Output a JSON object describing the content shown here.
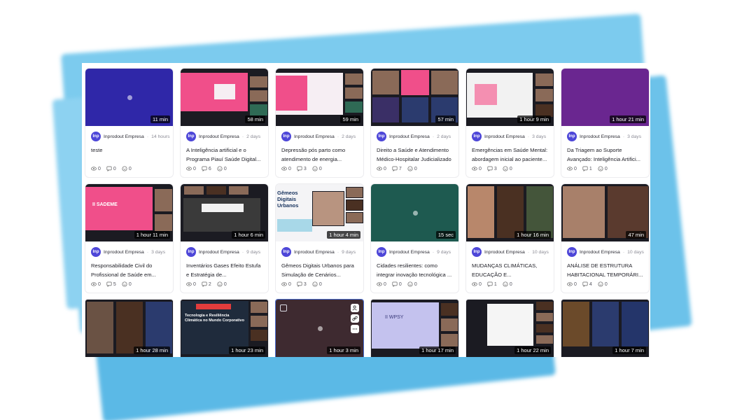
{
  "cards": [
    {
      "duration": "11 min",
      "author": "Inprodout Empresa",
      "time": "14 hours",
      "title": "teste",
      "views": "0",
      "comments": "0",
      "reactions": "0"
    },
    {
      "duration": "58 min",
      "author": "Inprodout Empresa",
      "time": "2 days",
      "title": "A Inteligência artificial e o Programa Piauí Saúde Digital...",
      "views": "0",
      "comments": "6",
      "reactions": "0"
    },
    {
      "duration": "59 min",
      "author": "Inprodout Empresa",
      "time": "2 days",
      "title": "Depressão pós parto como atendimento de energia...",
      "views": "0",
      "comments": "3",
      "reactions": "0"
    },
    {
      "duration": "57 min",
      "author": "Inprodout Empresa",
      "time": "2 days",
      "title": "Direito a Saúde e Atendimento Médico-Hospitalar Judicializado",
      "views": "0",
      "comments": "7",
      "reactions": "0"
    },
    {
      "duration": "1 hour 9 min",
      "author": "Inprodout Empresa",
      "time": "3 days",
      "title": "Emergências em Saúde Mental: abordagem inicial ao paciente...",
      "views": "0",
      "comments": "3",
      "reactions": "0"
    },
    {
      "duration": "1 hour 21 min",
      "author": "Inprodout Empresa",
      "time": "3 days",
      "title": "Da Triagem ao Suporte Avançado: Inteligência Artifici...",
      "views": "0",
      "comments": "1",
      "reactions": "0"
    },
    {
      "duration": "1 hour 11 min",
      "author": "Inprodout Empresa",
      "time": "3 days",
      "title": "Responsabilidade Civil do Profissional de Saúde em...",
      "views": "0",
      "comments": "5",
      "reactions": "0"
    },
    {
      "duration": "1 hour 6 min",
      "author": "Inprodout Empresa",
      "time": "9 days",
      "title": "Inventários Gases Efeito Estufa e Estratégia de...",
      "views": "0",
      "comments": "2",
      "reactions": "0"
    },
    {
      "duration": "1 hour 4 min",
      "author": "Inprodout Empresa",
      "time": "9 days",
      "title": "Gêmeos Digitais Urbanos para Simulação de Cenários...",
      "views": "0",
      "comments": "3",
      "reactions": "0"
    },
    {
      "duration": "15 sec",
      "author": "Inprodout Empresa",
      "time": "9 days",
      "title": "Cidades resilientes: como integrar inovação tecnológica ...",
      "views": "0",
      "comments": "0",
      "reactions": "0"
    },
    {
      "duration": "1 hour 16 min",
      "author": "Inprodout Empresa",
      "time": "10 days",
      "title": "MUDANÇAS CLIMÁTICAS, EDUCAÇÃO E...",
      "views": "0",
      "comments": "1",
      "reactions": "0"
    },
    {
      "duration": "47 min",
      "author": "Inprodout Empresa",
      "time": "10 days",
      "title": "ANÁLISE DE ESTRUTURA HABITACIONAL TEMPORÁRI...",
      "views": "0",
      "comments": "4",
      "reactions": "0"
    },
    {
      "duration": "1 hour 28 min"
    },
    {
      "duration": "1 hour 23 min"
    },
    {
      "duration": "1 hour 3 min"
    },
    {
      "duration": "1 hour 17 min"
    },
    {
      "duration": "1 hour 22 min"
    },
    {
      "duration": "1 hour 7 min"
    }
  ],
  "slide_text": {
    "sadseme": "II SADEME",
    "gemeos": "Gêmeos Digitais Urbanos",
    "wpsy": "II WPSY",
    "tecnologia": "Tecnologia e Resiliência Climática no Mundo Corporativo"
  },
  "avatar_text": "Inp",
  "colors": {
    "accent": "#4d46d8",
    "selected_border": "#4a6fd6",
    "backdrop": "#6ec3ea"
  }
}
